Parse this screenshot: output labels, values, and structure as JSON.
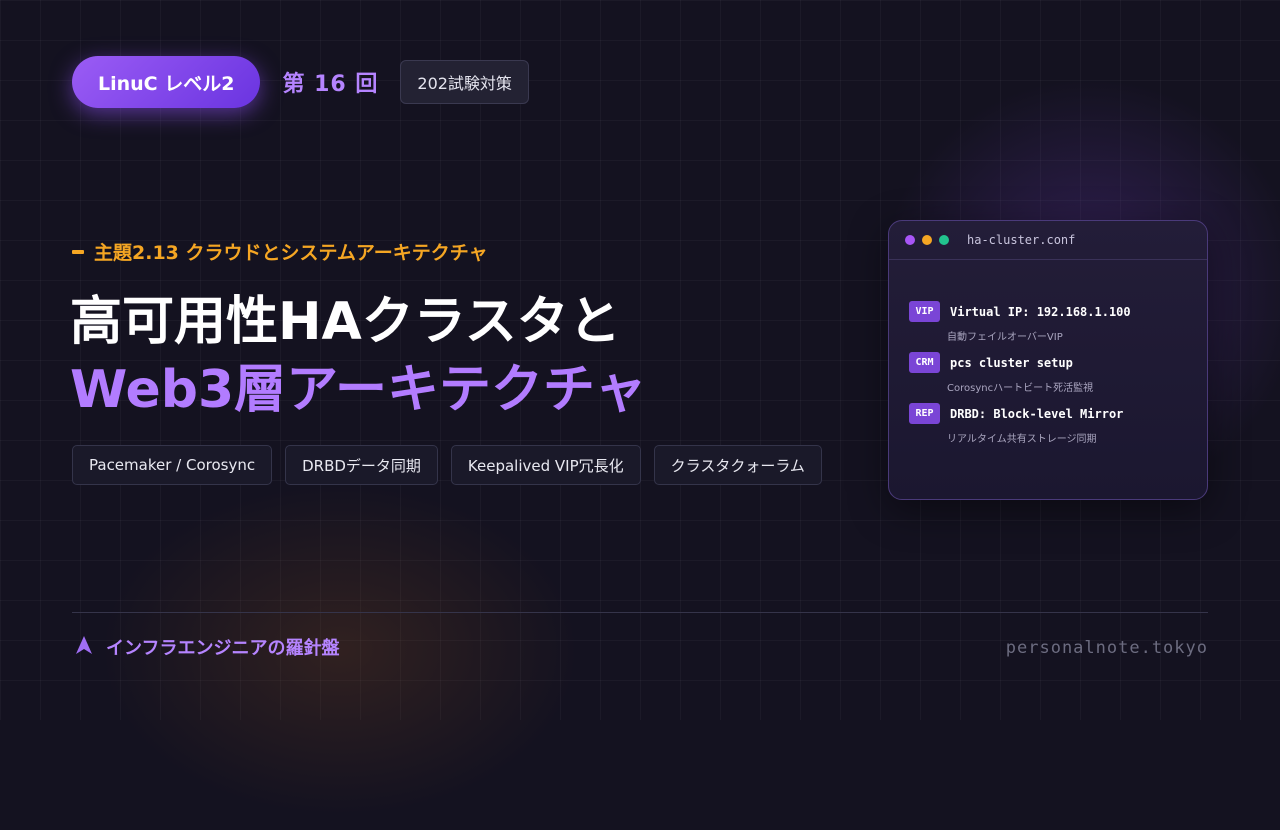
{
  "header": {
    "level_label": "LinuC レベル2",
    "episode_label": "第 16 回",
    "exam_label": "202試験対策"
  },
  "topic": "主題2.13 クラウドとシステムアーキテクチャ",
  "title": {
    "line1": "高可用性HAクラスタと",
    "line2": "Web3層アーキテクチャ"
  },
  "tags": [
    "Pacemaker / Corosync",
    "DRBDデータ同期",
    "Keepalived VIP冗長化",
    "クラスタクォーラム"
  ],
  "config_card": {
    "filename": "ha-cluster.conf",
    "window_dot_colors": [
      "#a855f7",
      "#f5a623",
      "#22c38e"
    ],
    "items": [
      {
        "badge": "VIP",
        "text": "Virtual IP: 192.168.1.100",
        "description": "自動フェイルオーバーVIP"
      },
      {
        "badge": "CRM",
        "text": "pcs cluster setup",
        "description": "Corosyncハートビート死活監視"
      },
      {
        "badge": "REP",
        "text": "DRBD: Block-level Mirror",
        "description": "リアルタイム共有ストレージ同期"
      }
    ]
  },
  "footer": {
    "brand": "インフラエンジニアの羅針盤",
    "site": "personalnote.tokyo",
    "brand_icon": "navigation-arrow-icon"
  },
  "colors": {
    "accent_purple": "#b27cff",
    "accent_orange": "#f5a623",
    "background": "#141220"
  }
}
